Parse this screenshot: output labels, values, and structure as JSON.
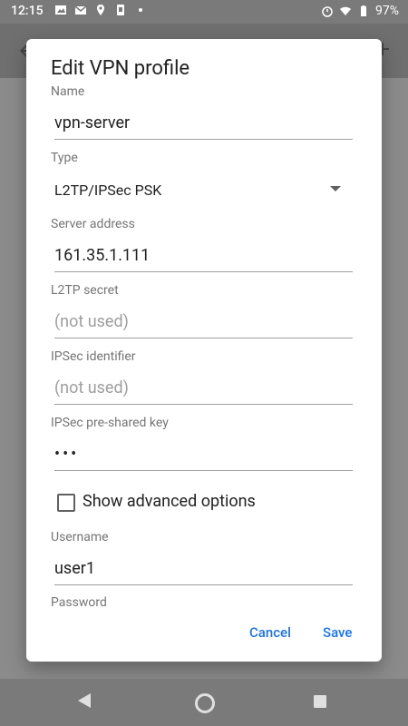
{
  "status_bar": {
    "time": "12:15",
    "battery": "97%",
    "left_icons": [
      "image-icon",
      "gmail-icon",
      "maps-icon",
      "sim-icon",
      "dot-icon"
    ],
    "right_icons": [
      "alarm-icon",
      "wifi-icon",
      "battery-icon"
    ]
  },
  "dialog": {
    "title": "Edit VPN profile",
    "fields": {
      "name": {
        "label": "Name",
        "value": "vpn-server"
      },
      "type": {
        "label": "Type",
        "value": "L2TP/IPSec PSK"
      },
      "server": {
        "label": "Server address",
        "value": "161.35.1.111"
      },
      "l2tp_secret": {
        "label": "L2TP secret",
        "placeholder": "(not used)"
      },
      "ipsec_identifier": {
        "label": "IPSec identifier",
        "placeholder": "(not used)"
      },
      "ipsec_psk": {
        "label": "IPSec pre-shared key",
        "value": "•••"
      },
      "username": {
        "label": "Username",
        "value": "user1"
      },
      "password": {
        "label": "Password"
      }
    },
    "advanced_checkbox_label": "Show advanced options",
    "buttons": {
      "cancel": "Cancel",
      "save": "Save"
    }
  },
  "nav": {
    "icons": [
      "back-icon",
      "home-icon",
      "recents-icon"
    ]
  }
}
